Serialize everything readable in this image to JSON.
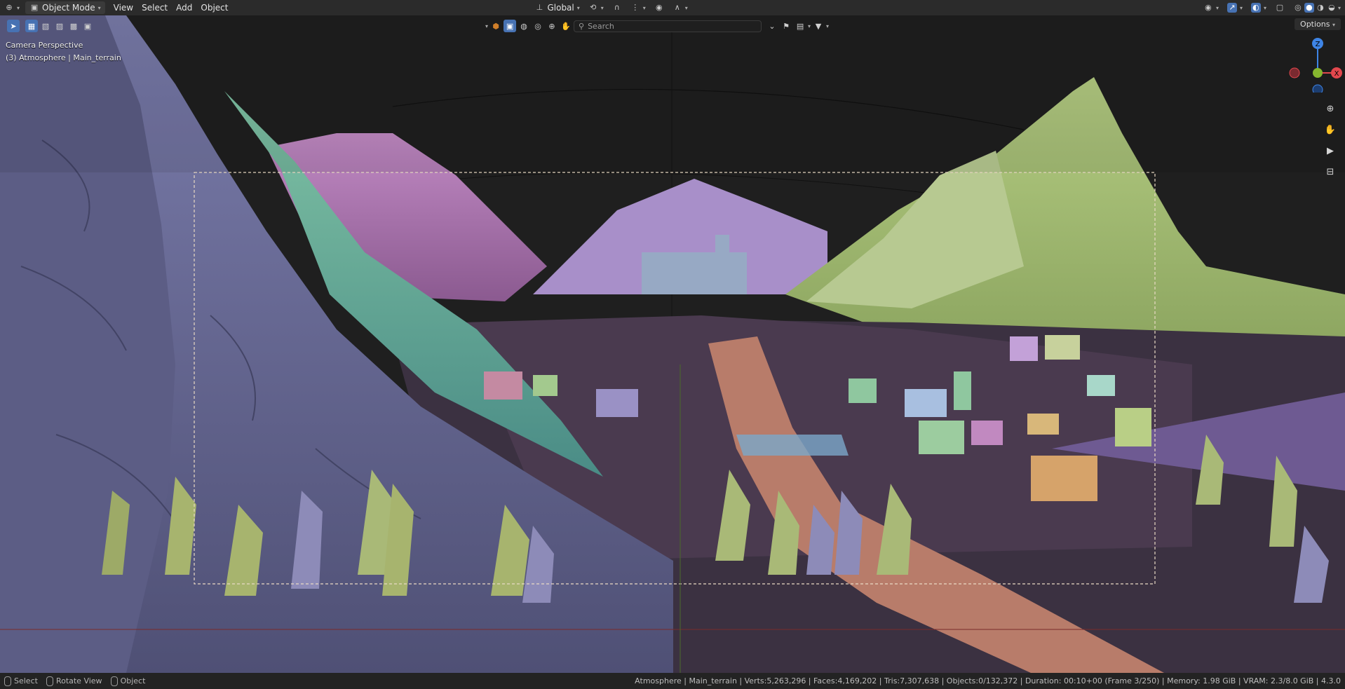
{
  "header": {
    "mode_label": "Object Mode",
    "menus": [
      "View",
      "Select",
      "Add",
      "Object"
    ],
    "orientation_label": "Global"
  },
  "viewport": {
    "search_placeholder": "Search",
    "options_label": "Options",
    "overlay_line1": "Camera Perspective",
    "overlay_line2": "(3) Atmosphere | Main_terrain",
    "gizmo_z": "Z",
    "gizmo_x": "X"
  },
  "statusbar": {
    "select_label": "Select",
    "rotate_label": "Rotate View",
    "object_label": "Object",
    "stats": "Atmosphere | Main_terrain | Verts:5,263,296 | Faces:4,169,202 | Tris:7,307,638 | Objects:0/132,372 | Duration: 00:10+00 (Frame 3/250) | Memory: 1.98 GiB | VRAM: 2.3/8.0 GiB | 4.3.0"
  },
  "colors": {
    "accent": "#4772b3",
    "header_bg": "#2b2b2b",
    "gizmo_x": "#e2474d",
    "gizmo_y": "#86b62f",
    "gizmo_z": "#3e84e5"
  }
}
